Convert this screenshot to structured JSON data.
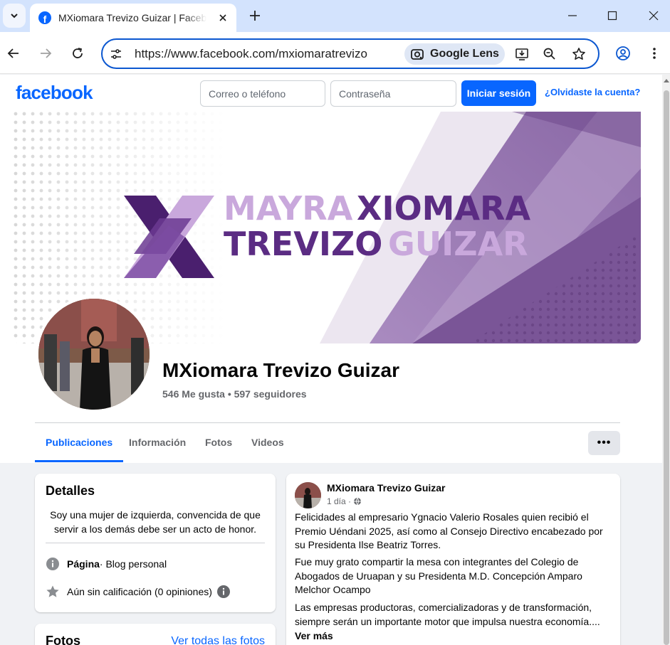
{
  "browser": {
    "tab_title": "MXiomara Trevizo Guizar | Facebook",
    "url": "https://www.facebook.com/mxiomaratrevizo",
    "lens_label": "Google Lens"
  },
  "fb_header": {
    "logo": "facebook",
    "email_placeholder": "Correo o teléfono",
    "password_placeholder": "Contraseña",
    "login_button": "Iniciar sesión",
    "forgot_link": "¿Olvidaste la cuenta?"
  },
  "cover": {
    "line1_a": "MAYRA",
    "line1_b": "XIOMARA",
    "line2_a": "TREVIZO",
    "line2_b": "GUIZAR",
    "colors": {
      "dark_purple": "#5b2c83",
      "light_purple": "#c9a8dc",
      "band": "#8d6aa8"
    }
  },
  "profile": {
    "name": "MXiomara Trevizo Guizar",
    "stats": "546 Me gusta • 597 seguidores"
  },
  "tabs": [
    "Publicaciones",
    "Información",
    "Fotos",
    "Videos"
  ],
  "more_label": "•••",
  "details": {
    "title": "Detalles",
    "bio": "Soy una mujer de izquierda, convencida de que servir a los demás debe ser un acto de honor.",
    "page_bold": "Página",
    "page_rest": " · Blog personal",
    "rating": "Aún sin calificación (0 opiniones)"
  },
  "photos": {
    "title": "Fotos",
    "see_all": "Ver todas las fotos"
  },
  "post": {
    "author": "MXiomara Trevizo Guizar",
    "time": "1 día ·",
    "p1": "Felicidades al empresario Ygnacio Valerio Rosales quien recibió el Premio Uéndani 2025, así como al Consejo Directivo encabezado por su Presidenta Ilse Beatriz Torres.",
    "p2": "Fue muy grato compartir la mesa con integrantes del Colegio de Abogados de Uruapan y su Presidenta M.D. Concepción Amparo Melchor Ocampo",
    "p3": "Las empresas productoras,  comercializadoras y de transformación, siempre serán un importante motor que impulsa nuestra economía....",
    "see_more": "Ver más"
  },
  "colors": {
    "fb_blue": "#0866ff",
    "chrome_tabstrip": "#d3e3fd",
    "omnibox_border": "#0b57d0"
  }
}
